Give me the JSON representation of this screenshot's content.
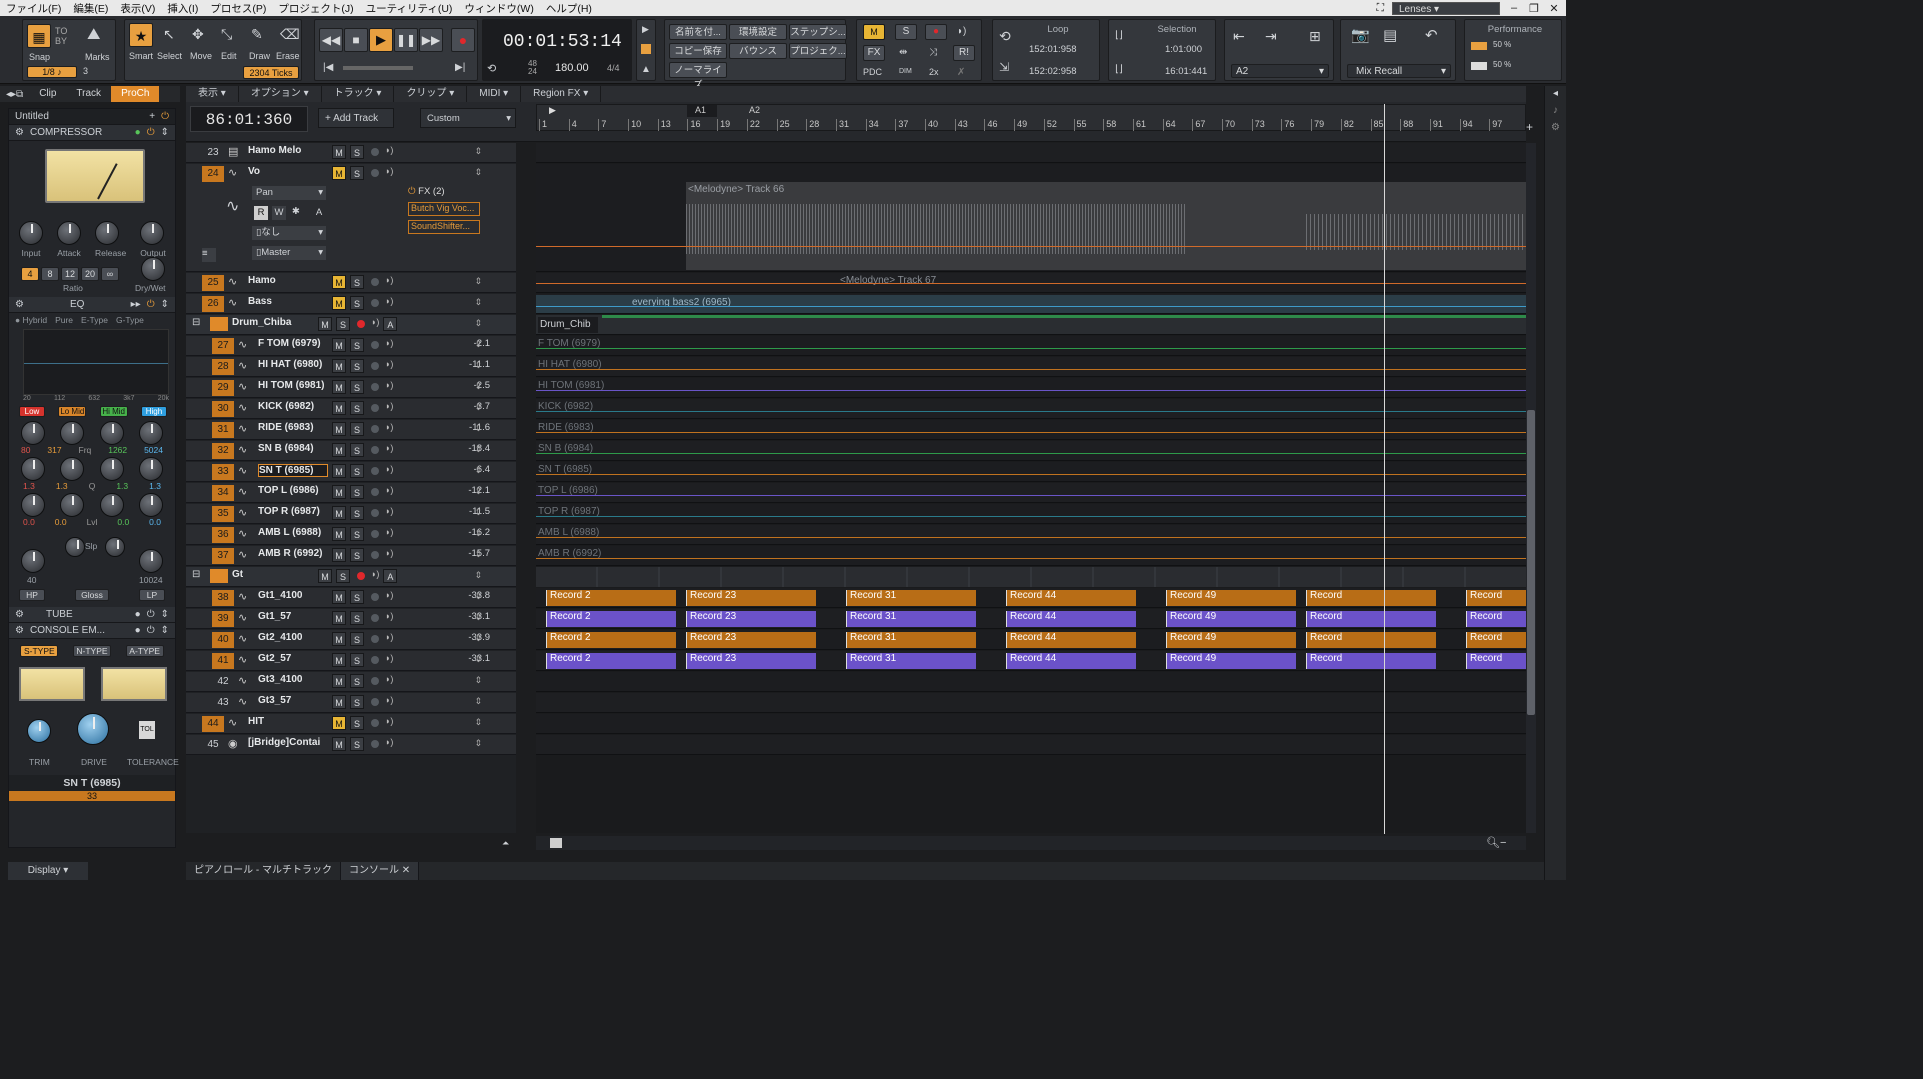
{
  "menu": [
    "ファイル(F)",
    "編集(E)",
    "表示(V)",
    "挿入(I)",
    "プロセス(P)",
    "プロジェクト(J)",
    "ユーティリティ(U)",
    "ウィンドウ(W)",
    "ヘルプ(H)"
  ],
  "lenses": "Lenses",
  "tools": {
    "snap": "Snap",
    "snap_value": "1/8",
    "snap_num": "3",
    "marks": "Marks",
    "smart": "Smart",
    "select": "Select",
    "move": "Move",
    "edit": "Edit",
    "draw": "Draw",
    "erase": "Erase",
    "ticks": "2304 Ticks"
  },
  "transport": {
    "time": "00:01:53:14",
    "tempo": "180.00",
    "meter": "4/4",
    "ts_top": "48",
    "ts_bottom": "24"
  },
  "quick": [
    "名前を付...",
    "環境設定",
    "ステップシ...",
    "コピー保存",
    "バウンス",
    "プロジェク...",
    "ノーマライズ"
  ],
  "mix": {
    "m": "M",
    "s": "S",
    "fx": "FX",
    "pdc": "PDC",
    "dim": "DIM",
    "x2": "2x",
    "ri": "R!"
  },
  "loop": {
    "title": "Loop",
    "start": "152:01:958",
    "end": "152:02:958"
  },
  "selection": {
    "title": "Selection",
    "start": "1:01:000",
    "end": "16:01:441"
  },
  "marker": {
    "value": "A2"
  },
  "mixrecall": "Mix Recall",
  "performance": {
    "title": "Performance",
    "cpu": "50 %",
    "disk": "50 %"
  },
  "inspector_tabs": [
    "Clip",
    "Track",
    "ProCh"
  ],
  "prochannel": {
    "preset": "Untitled",
    "compressor": "COMPRESSOR",
    "comp_knobs": [
      "Input",
      "Attack",
      "Release",
      "Output"
    ],
    "ratios": [
      "4",
      "8",
      "12",
      "20",
      "∞"
    ],
    "ratio_label": "Ratio",
    "drywet": "Dry/Wet",
    "eq": "EQ",
    "eq_modes": [
      "Hybrid",
      "Pure",
      "E-Type",
      "G-Type"
    ],
    "eq_freqs": [
      "20",
      "112",
      "632",
      "3k7",
      "20k"
    ],
    "bands": [
      "Low",
      "Lo Mid",
      "Hi Mid",
      "High"
    ],
    "freq_vals": [
      "80",
      "317",
      "1262",
      "5024"
    ],
    "q_vals": [
      "1.3",
      "1.3",
      "1.3",
      "1.3"
    ],
    "gain_vals": [
      "0.0",
      "0.0",
      "0.0",
      "0.0"
    ],
    "freq_label": "Frq",
    "q_label": "Q",
    "lvl_label": "Lvl",
    "slp": "Slp",
    "hp": "HP",
    "hp_val": "40",
    "gloss": "Gloss",
    "lp": "LP",
    "lp_val": "10024",
    "tube": "TUBE",
    "console": "CONSOLE EM...",
    "types": [
      "S-TYPE",
      "N-TYPE",
      "A-TYPE"
    ],
    "console_knobs": [
      "TRIM",
      "DRIVE",
      "TOLERANCE"
    ],
    "track_name": "SN T (6985)",
    "track_num": "33",
    "display": "Display"
  },
  "viewmenu": [
    "表示",
    "オプション",
    "トラック",
    "クリップ",
    "MIDI",
    "Region FX"
  ],
  "now_time": "86:01:360",
  "add_track": "Add Track",
  "custom": "Custom",
  "ruler": [
    "1",
    "4",
    "7",
    "10",
    "13",
    "16",
    "19",
    "22",
    "25",
    "28",
    "31",
    "34",
    "37",
    "40",
    "43",
    "46",
    "49",
    "52",
    "55",
    "58",
    "61",
    "64",
    "67",
    "70",
    "73",
    "76",
    "79",
    "82",
    "85",
    "88",
    "91",
    "94",
    "97"
  ],
  "markers": [
    "A1",
    "A2"
  ],
  "tracks": [
    {
      "n": "23",
      "name": "Hamo Melo",
      "vol": "",
      "o": false
    },
    {
      "n": "24",
      "name": "Vo",
      "vol": "",
      "o": true
    },
    {
      "n": "25",
      "name": "Hamo",
      "vol": "",
      "o": true
    },
    {
      "n": "26",
      "name": "Bass",
      "vol": "",
      "o": true
    },
    {
      "n": "",
      "name": "Drum_Chiba",
      "vol": "",
      "o": false
    },
    {
      "n": "27",
      "name": "F TOM (6979)",
      "vol": "-2.1",
      "o": true
    },
    {
      "n": "28",
      "name": "HI HAT (6980)",
      "vol": "-11.1",
      "o": true
    },
    {
      "n": "29",
      "name": "HI TOM (6981)",
      "vol": "-2.5",
      "o": true
    },
    {
      "n": "30",
      "name": "KICK (6982)",
      "vol": "-3.7",
      "o": true
    },
    {
      "n": "31",
      "name": "RIDE (6983)",
      "vol": "-11.6",
      "o": true
    },
    {
      "n": "32",
      "name": "SN B (6984)",
      "vol": "-18.4",
      "o": true
    },
    {
      "n": "33",
      "name": "SN T (6985)",
      "vol": "-6.4",
      "o": true
    },
    {
      "n": "34",
      "name": "TOP L (6986)",
      "vol": "-12.1",
      "o": true
    },
    {
      "n": "35",
      "name": "TOP R (6987)",
      "vol": "-11.5",
      "o": true
    },
    {
      "n": "36",
      "name": "AMB L (6988)",
      "vol": "-16.2",
      "o": true
    },
    {
      "n": "37",
      "name": "AMB R (6992)",
      "vol": "-15.7",
      "o": true
    },
    {
      "n": "",
      "name": "Gt",
      "vol": "",
      "o": false
    },
    {
      "n": "38",
      "name": "Gt1_4100",
      "vol": "-33.8",
      "o": true
    },
    {
      "n": "39",
      "name": "Gt1_57",
      "vol": "-33.1",
      "o": true
    },
    {
      "n": "40",
      "name": "Gt2_4100",
      "vol": "-33.9",
      "o": true
    },
    {
      "n": "41",
      "name": "Gt2_57",
      "vol": "-33.1",
      "o": true
    },
    {
      "n": "42",
      "name": "Gt3_4100",
      "vol": "",
      "o": false
    },
    {
      "n": "43",
      "name": "Gt3_57",
      "vol": "",
      "o": false
    },
    {
      "n": "44",
      "name": "HIT",
      "vol": "",
      "o": true
    },
    {
      "n": "45",
      "name": "[jBridge]Contai",
      "vol": "",
      "o": false
    }
  ],
  "vo_extra": {
    "pan": "Pan",
    "fx": "FX (2)",
    "fx1": "Butch Vig Voc...",
    "fx2": "SoundShifter...",
    "input": "なし",
    "output": "Master",
    "rw": [
      "R",
      "W",
      "A"
    ]
  },
  "lane_labels": {
    "vo": "<Melodyne> Track 66",
    "hamo": "<Melodyne> Track 67",
    "bass": "everying bass2 (6965)",
    "drumfolder": "Drum_Chib",
    "drums": [
      "F TOM (6979)",
      "HI HAT (6980)",
      "HI TOM (6981)",
      "KICK (6982)",
      "RIDE (6983)",
      "SN B (6984)",
      "SN T (6985)",
      "TOP L (6986)",
      "TOP R (6987)",
      "AMB L (6988)",
      "AMB R (6992)"
    ],
    "gt": [
      "Record 2",
      "Record 23",
      "Record 31",
      "Record 44",
      "Record 49",
      "Record"
    ]
  },
  "bottom_tabs": [
    "ピアノロール - マルチトラック",
    "コンソール"
  ],
  "colors": {
    "accent": "#e08a2a",
    "record": "#e0282c",
    "mute": "#e7b534"
  }
}
